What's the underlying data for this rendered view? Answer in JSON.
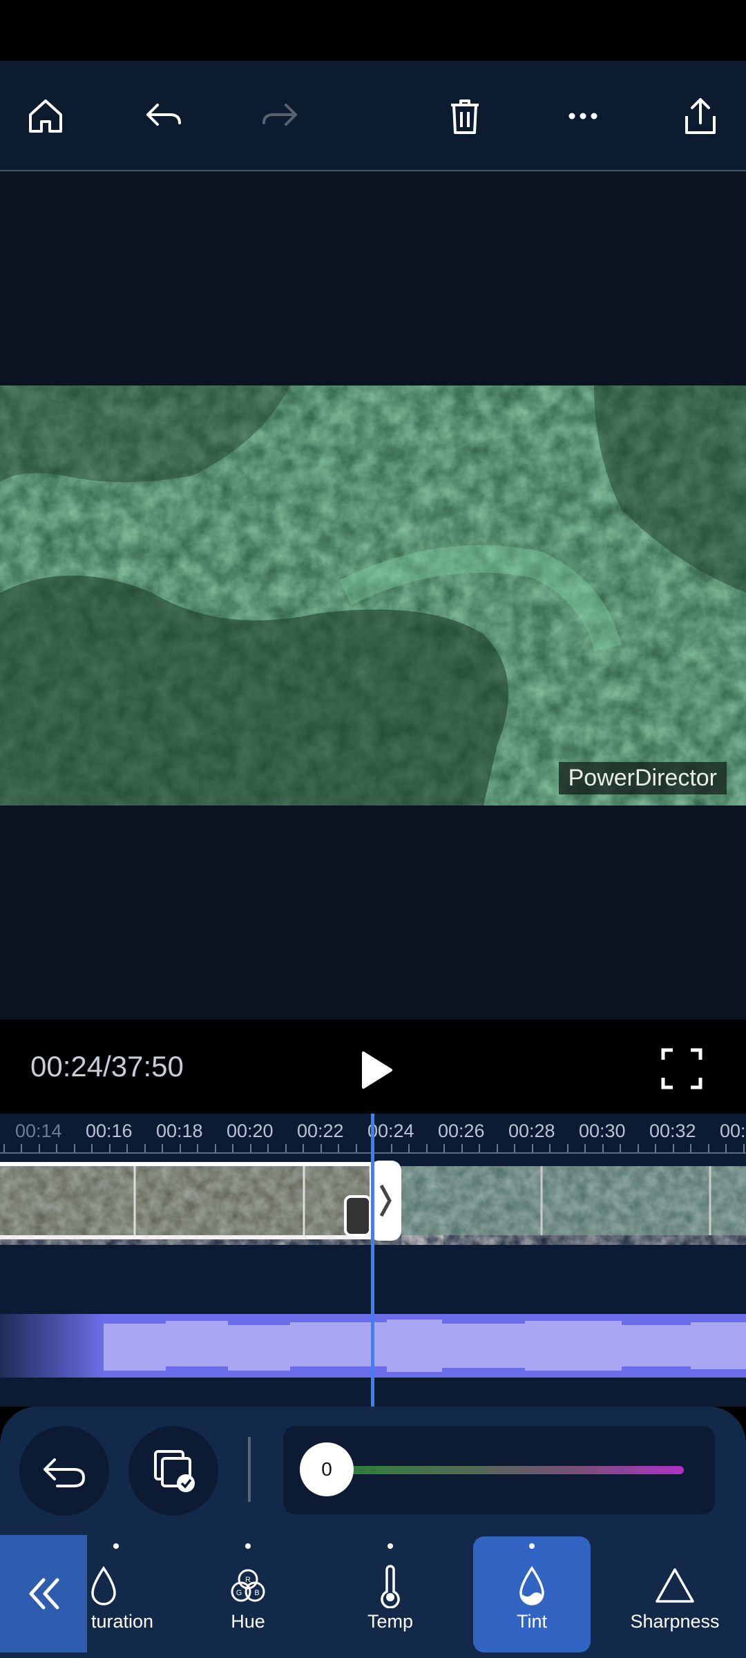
{
  "toolbar": {
    "icons": [
      "home-icon",
      "undo-icon",
      "redo-icon",
      "trash-icon",
      "more-icon",
      "share-icon"
    ]
  },
  "preview": {
    "watermark": "PowerDirector"
  },
  "player": {
    "time": "00:24/37:50"
  },
  "timeline": {
    "ticks": [
      "00:14",
      "00:16",
      "00:18",
      "00:20",
      "00:22",
      "00:24",
      "00:26",
      "00:28",
      "00:30",
      "00:32",
      "00:"
    ],
    "playhead_color": "#3b82f6"
  },
  "adjust": {
    "slider_value": "0",
    "tools": [
      {
        "label": "turation",
        "icon": "saturation-drop-icon"
      },
      {
        "label": "Hue",
        "icon": "rgb-circles-icon"
      },
      {
        "label": "Temp",
        "icon": "thermometer-icon"
      },
      {
        "label": "Tint",
        "icon": "tint-drop-icon",
        "selected": true
      },
      {
        "label": "Sharpness",
        "icon": "triangle-icon"
      }
    ]
  },
  "colors": {
    "accent": "#3264c4",
    "toolbar_bg": "#0d1b2e",
    "panel_bg": "#13294a"
  }
}
